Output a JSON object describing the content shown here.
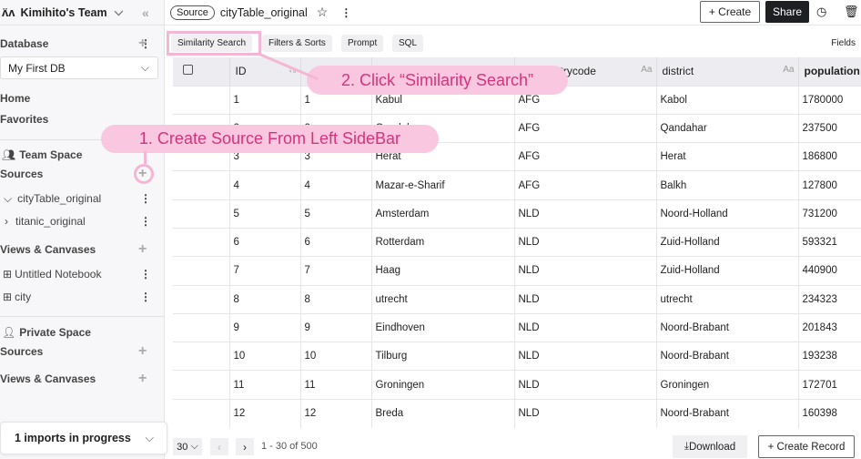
{
  "sidebar": {
    "team": "Kimihito's Team",
    "database_label": "Database",
    "db_selected": "My First DB",
    "home": "Home",
    "favorites": "Favorites",
    "team_space": "Team Space",
    "sources": "Sources",
    "source_items": [
      "cityTable_original",
      "titanic_original"
    ],
    "views": "Views & Canvases",
    "view_items": [
      "Untitled Notebook",
      "city"
    ],
    "private_space": "Private Space",
    "private_sources": "Sources",
    "private_views": "Views & Canvases",
    "imports": "1 imports in progress"
  },
  "header": {
    "badge": "Source",
    "title": "cityTable_original",
    "create": "+ Create",
    "share": "Share"
  },
  "toolbar": {
    "similarity": "Similarity Search",
    "filters": "Filters & Sorts",
    "prompt": "Prompt",
    "sql": "SQL",
    "fields": "Fields"
  },
  "table": {
    "headers": [
      "ID",
      "",
      "",
      "countrycode",
      "district",
      "population"
    ],
    "type_icon": "Aa",
    "rows": [
      [
        "1",
        "1",
        "Kabul",
        "AFG",
        "Kabol",
        "1780000"
      ],
      [
        "2",
        "2",
        "Qandahar",
        "AFG",
        "Qandahar",
        "237500"
      ],
      [
        "3",
        "3",
        "Herat",
        "AFG",
        "Herat",
        "186800"
      ],
      [
        "4",
        "4",
        "Mazar-e-Sharif",
        "AFG",
        "Balkh",
        "127800"
      ],
      [
        "5",
        "5",
        "Amsterdam",
        "NLD",
        "Noord-Holland",
        "731200"
      ],
      [
        "6",
        "6",
        "Rotterdam",
        "NLD",
        "Zuid-Holland",
        "593321"
      ],
      [
        "7",
        "7",
        "Haag",
        "NLD",
        "Zuid-Holland",
        "440900"
      ],
      [
        "8",
        "8",
        "utrecht",
        "NLD",
        "utrecht",
        "234323"
      ],
      [
        "9",
        "9",
        "Eindhoven",
        "NLD",
        "Noord-Brabant",
        "201843"
      ],
      [
        "10",
        "10",
        "Tilburg",
        "NLD",
        "Noord-Brabant",
        "193238"
      ],
      [
        "11",
        "11",
        "Groningen",
        "NLD",
        "Groningen",
        "172701"
      ],
      [
        "12",
        "12",
        "Breda",
        "NLD",
        "Noord-Brabant",
        "160398"
      ]
    ]
  },
  "footer": {
    "page_size": "30",
    "range": "1 - 30 of 500",
    "download": "Download",
    "create_record": "+ Create Record"
  },
  "callouts": {
    "step1": "1. Create Source From Left SideBar",
    "step2": "2. Click “Similarity Search”"
  },
  "colors": {
    "callout_bg": "#f9c7df",
    "callout_text": "#d6337d",
    "share_bg": "#1d1f22"
  }
}
